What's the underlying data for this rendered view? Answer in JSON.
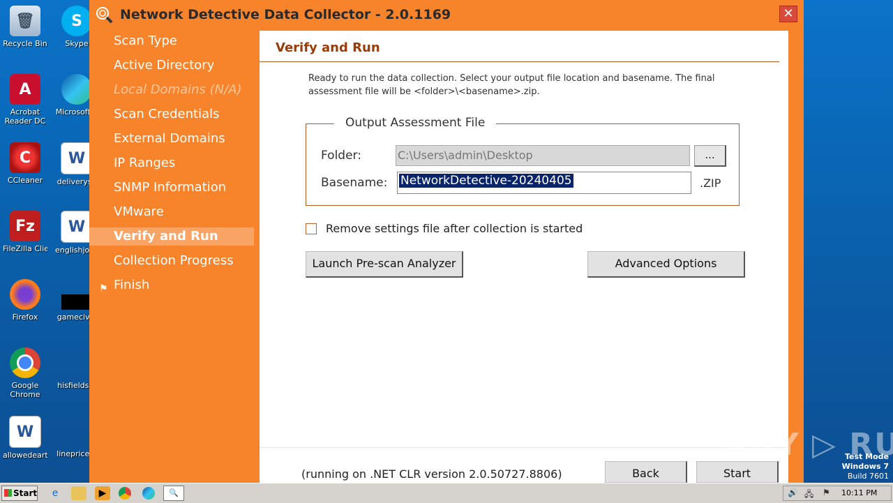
{
  "desktop": {
    "icons": [
      {
        "label": "Recycle Bin"
      },
      {
        "label": "Skype"
      },
      {
        "label": "Acrobat Reader DC"
      },
      {
        "label": "Microsoft E"
      },
      {
        "label": "CCleaner"
      },
      {
        "label": "deliveryse"
      },
      {
        "label": "FileZilla Client"
      },
      {
        "label": "englishjobs"
      },
      {
        "label": "Firefox"
      },
      {
        "label": "gamecivil."
      },
      {
        "label": "Google Chrome"
      },
      {
        "label": "hisfields.p"
      },
      {
        "label": "allowedeart..."
      },
      {
        "label": "lineprice.p"
      }
    ]
  },
  "window": {
    "title": "Network Detective Data Collector - 2.0.1169",
    "close_label": "✕"
  },
  "nav": {
    "items": [
      {
        "label": "Scan Type"
      },
      {
        "label": "Active Directory"
      },
      {
        "label": "Local Domains (N/A)"
      },
      {
        "label": "Scan Credentials"
      },
      {
        "label": "External Domains"
      },
      {
        "label": "IP Ranges"
      },
      {
        "label": "SNMP Information"
      },
      {
        "label": "VMware"
      },
      {
        "label": "Verify and Run"
      },
      {
        "label": "Collection Progress"
      },
      {
        "label": "Finish"
      }
    ],
    "active_index": 8
  },
  "panel": {
    "title": "Verify and Run",
    "description": "Ready to run the data collection.  Select your output file location and basename. The final assessment file will be <folder>\\<basename>.zip.",
    "group_title": "Output Assessment File",
    "folder_label": "Folder:",
    "folder_value": "C:\\Users\\admin\\Desktop",
    "browse_label": "...",
    "basename_label": "Basename:",
    "basename_value": "NetworkDetective-20240405",
    "zip_label": ".ZIP",
    "checkbox_label": "Remove settings file after collection is started",
    "checkbox_checked": false,
    "prescan_label": "Launch Pre-scan Analyzer",
    "advanced_label": "Advanced Options",
    "clr_text": "(running on .NET CLR version 2.0.50727.8806)",
    "back_label": "Back",
    "start_label": "Start"
  },
  "watermark": {
    "text": "ANY ▷ RUN"
  },
  "system": {
    "testmode_line1": "Test Mode",
    "testmode_line2": "Windows 7",
    "testmode_line3": "Build 7601"
  },
  "taskbar": {
    "start_label": "Start",
    "clock": "10:11 PM"
  },
  "colors": {
    "window_orange": "#f7832a",
    "title_accent": "#9a3c08",
    "selection": "#0a246a"
  }
}
